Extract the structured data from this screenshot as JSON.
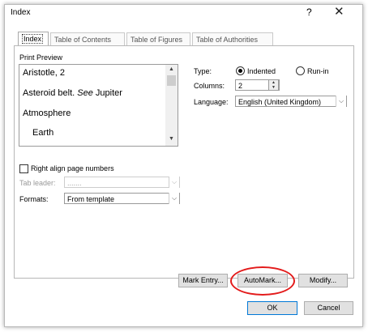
{
  "window": {
    "title": "Index",
    "help": "?",
    "close": "✕"
  },
  "tabs": [
    "Index",
    "Table of Contents",
    "Table of Figures",
    "Table of Authorities"
  ],
  "print_preview": {
    "label": "Print Preview",
    "lines": [
      "Aristotle, 2",
      "Asteroid belt.",
      "See",
      "Jupiter",
      "Atmosphere",
      "Earth"
    ]
  },
  "type": {
    "label": "Type:",
    "options": [
      "Indented",
      "Run-in"
    ],
    "selected": "Indented"
  },
  "columns": {
    "label": "Columns:",
    "value": "2"
  },
  "language": {
    "label": "Language:",
    "value": "English (United Kingdom)"
  },
  "right_align": {
    "label": "Right align page numbers",
    "checked": false
  },
  "tab_leader": {
    "label": "Tab leader:",
    "value": "......."
  },
  "formats": {
    "label": "Formats:",
    "value": "From template"
  },
  "buttons": {
    "mark_entry": "Mark Entry...",
    "automark": "AutoMark...",
    "modify": "Modify...",
    "ok": "OK",
    "cancel": "Cancel"
  }
}
